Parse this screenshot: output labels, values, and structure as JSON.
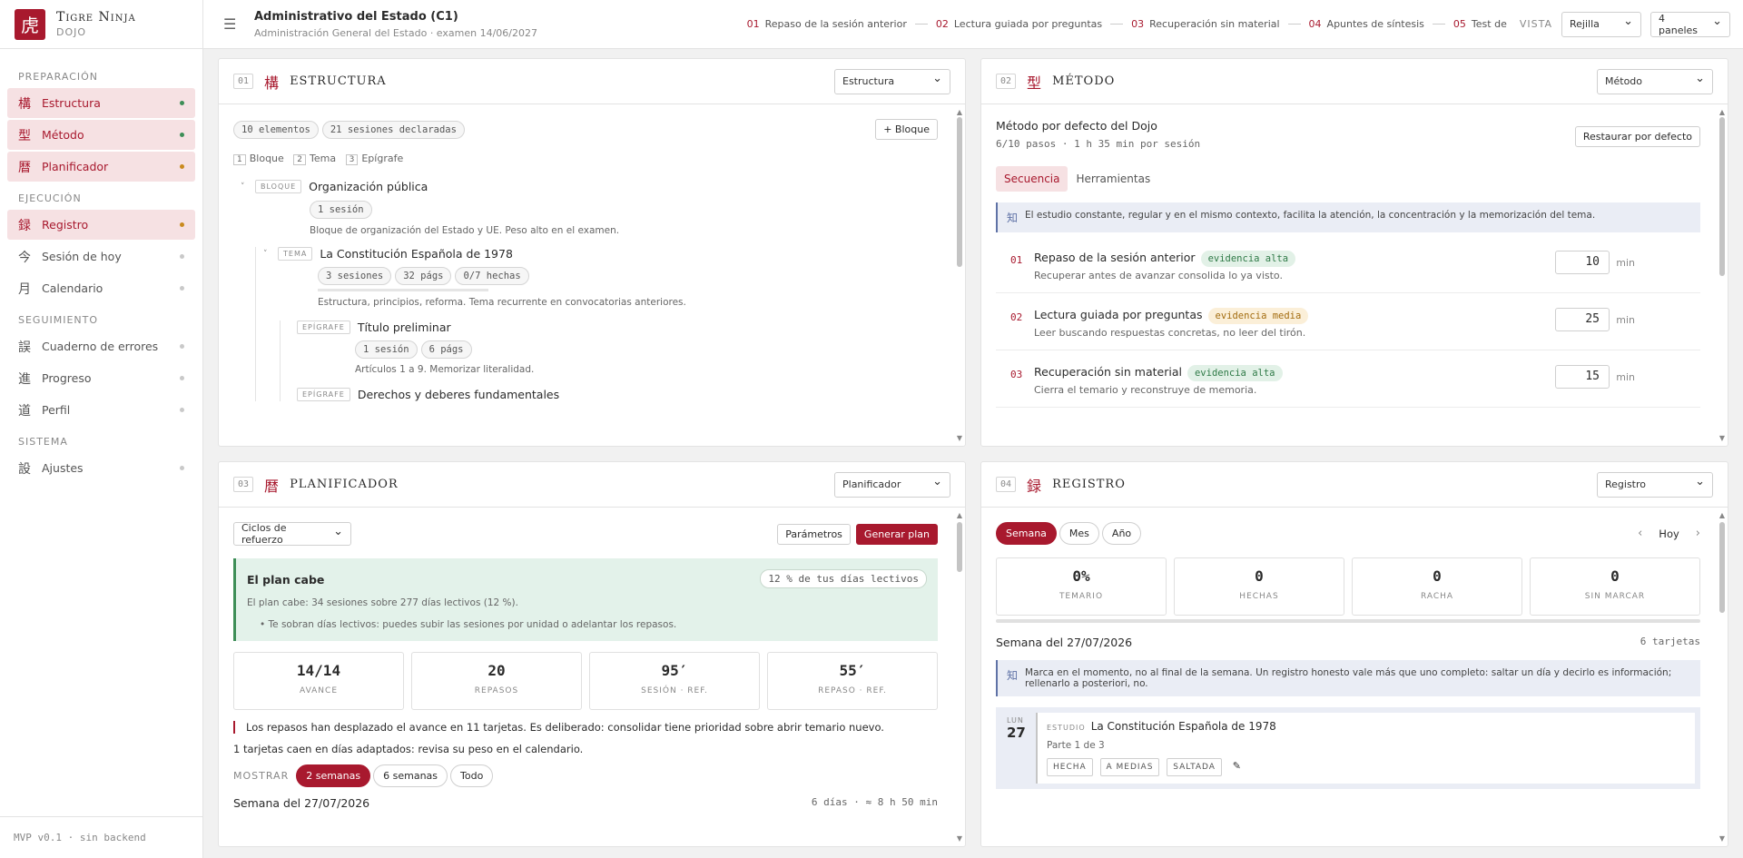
{
  "brand": {
    "logo": "虎",
    "title": "Tigre Ninja",
    "sub": "DOJO"
  },
  "sidebar": {
    "sections": [
      {
        "title": "PREPARACIÓN",
        "items": [
          {
            "kanji": "構",
            "label": "Estructura"
          },
          {
            "kanji": "型",
            "label": "Método"
          },
          {
            "kanji": "暦",
            "label": "Planificador"
          }
        ]
      },
      {
        "title": "EJECUCIÓN",
        "items": [
          {
            "kanji": "録",
            "label": "Registro"
          },
          {
            "kanji": "今",
            "label": "Sesión de hoy"
          },
          {
            "kanji": "月",
            "label": "Calendario"
          }
        ]
      },
      {
        "title": "SEGUIMIENTO",
        "items": [
          {
            "kanji": "誤",
            "label": "Cuaderno de errores"
          },
          {
            "kanji": "進",
            "label": "Progreso"
          },
          {
            "kanji": "道",
            "label": "Perfil"
          }
        ]
      },
      {
        "title": "SISTEMA",
        "items": [
          {
            "kanji": "設",
            "label": "Ajustes"
          }
        ]
      }
    ],
    "footer": "MVP v0.1 · sin backend"
  },
  "topbar": {
    "title": "Administrativo del Estado (C1)",
    "subtitle": "Administración General del Estado · examen 14/06/2027",
    "steps": [
      {
        "n": "01",
        "label": "Repaso de la sesión anterior"
      },
      {
        "n": "02",
        "label": "Lectura guiada por preguntas"
      },
      {
        "n": "03",
        "label": "Recuperación sin material"
      },
      {
        "n": "04",
        "label": "Apuntes de síntesis"
      },
      {
        "n": "05",
        "label": "Test de"
      }
    ],
    "vista_label": "VISTA",
    "vista_value": "Rejilla",
    "panels_value": "4 paneles"
  },
  "estructura": {
    "num": "01",
    "kanji": "構",
    "title": "ESTRUCTURA",
    "select": "Estructura",
    "chips": [
      "10 elementos",
      "21 sesiones declaradas"
    ],
    "add_button": "+ Bloque",
    "legend": [
      {
        "n": "1",
        "label": "Bloque"
      },
      {
        "n": "2",
        "label": "Tema"
      },
      {
        "n": "3",
        "label": "Epígrafe"
      }
    ],
    "block": {
      "tag": "BLOQUE",
      "title": "Organización pública",
      "chip": "1 sesión",
      "desc": "Bloque de organización del Estado y UE. Peso alto en el examen."
    },
    "tema": {
      "tag": "TEMA",
      "title": "La Constitución Española de 1978",
      "chips": [
        "3 sesiones",
        "32 págs",
        "0/7 hechas"
      ],
      "desc": "Estructura, principios, reforma. Tema recurrente en convocatorias anteriores."
    },
    "epigrafe1": {
      "tag": "EPÍGRAFE",
      "title": "Título preliminar",
      "chips": [
        "1 sesión",
        "6 págs"
      ],
      "desc": "Artículos 1 a 9. Memorizar literalidad."
    },
    "epigrafe2": {
      "tag": "EPÍGRAFE",
      "title": "Derechos y deberes fundamentales"
    }
  },
  "metodo": {
    "num": "02",
    "kanji": "型",
    "title": "MÉTODO",
    "select": "Método",
    "heading": "Método por defecto del Dojo",
    "meta": "6/10 pasos · 1 h 35 min por sesión",
    "restore": "Restaurar por defecto",
    "tabs": [
      "Secuencia",
      "Herramientas"
    ],
    "info_kanji": "知",
    "info": "El estudio constante, regular y en el mismo contexto, facilita la atención, la concentración y la memorización del tema.",
    "steps": [
      {
        "n": "01",
        "title": "Repaso de la sesión anterior",
        "ev": "evidencia alta",
        "level": "alta",
        "desc": "Recuperar antes de avanzar consolida lo ya visto.",
        "min": "10"
      },
      {
        "n": "02",
        "title": "Lectura guiada por preguntas",
        "ev": "evidencia media",
        "level": "media",
        "desc": "Leer buscando respuestas concretas, no leer del tirón.",
        "min": "25"
      },
      {
        "n": "03",
        "title": "Recuperación sin material",
        "ev": "evidencia alta",
        "level": "alta",
        "desc": "Cierra el temario y reconstruye de memoria.",
        "min": "15"
      }
    ],
    "min_label": "min"
  },
  "planificador": {
    "num": "03",
    "kanji": "暦",
    "title": "PLANIFICADOR",
    "select": "Planificador",
    "mode": "Ciclos de refuerzo",
    "params": "Parámetros",
    "generate": "Generar plan",
    "ok_title": "El plan cabe",
    "ok_badge": "12 % de tus días lectivos",
    "ok_desc": "El plan cabe: 34 sesiones sobre 277 días lectivos (12 %).",
    "ok_bullet": "Te sobran días lectivos: puedes subir las sesiones por unidad o adelantar los repasos.",
    "stats": [
      {
        "v": "14/14",
        "l": "AVANCE"
      },
      {
        "v": "20",
        "l": "REPASOS"
      },
      {
        "v": "95′",
        "l": "SESIÓN · REF."
      },
      {
        "v": "55′",
        "l": "REPASO · REF."
      }
    ],
    "note1": "Los repasos han desplazado el avance en 11 tarjetas. Es deliberado: consolidar tiene prioridad sobre abrir temario nuevo.",
    "note2": "1 tarjetas caen en días adaptados: revisa su peso en el calendario.",
    "show_label": "MOSTRAR",
    "show_options": [
      "2 semanas",
      "6 semanas",
      "Todo"
    ],
    "week": "Semana del 27/07/2026",
    "week_meta": "6 días · ≈ 8 h 50 min"
  },
  "registro": {
    "num": "04",
    "kanji": "録",
    "title": "REGISTRO",
    "select": "Registro",
    "ranges": [
      "Semana",
      "Mes",
      "Año"
    ],
    "today": "Hoy",
    "prev": "‹",
    "next": "›",
    "stats": [
      {
        "v": "0%",
        "l": "TEMARIO"
      },
      {
        "v": "0",
        "l": "HECHAS"
      },
      {
        "v": "0",
        "l": "RACHA"
      },
      {
        "v": "0",
        "l": "SIN MARCAR"
      }
    ],
    "week": "Semana del 27/07/2026",
    "week_meta": "6 tarjetas",
    "info_kanji": "知",
    "info": "Marca en el momento, no al final de la semana. Un registro honesto vale más que uno completo: saltar un día y decirlo es información; rellenarlo a posteriori, no.",
    "card": {
      "dw": "LUN",
      "dn": "27",
      "tag": "ESTUDIO",
      "title": "La Constitución Española de 1978",
      "sub": "Parte 1 de 3",
      "actions": [
        "HECHA",
        "A MEDIAS",
        "SALTADA"
      ]
    }
  }
}
